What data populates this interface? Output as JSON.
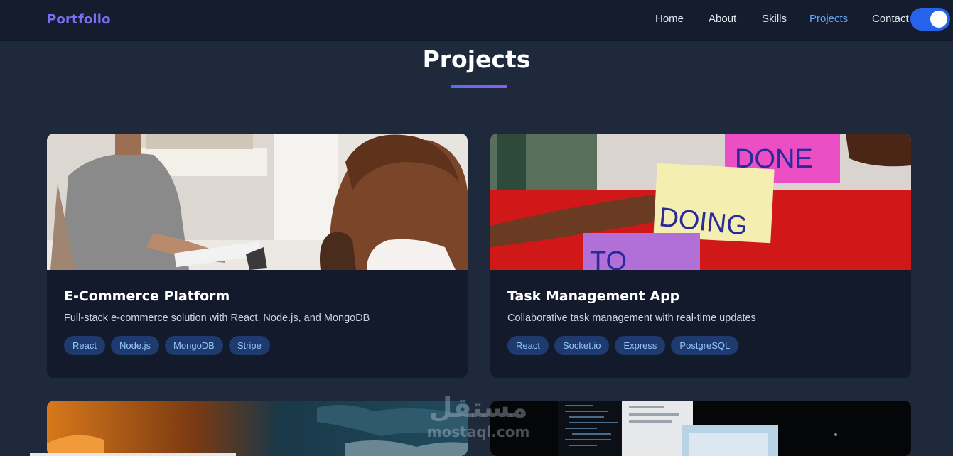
{
  "nav": {
    "logo": "Portfolio",
    "links": [
      {
        "label": "Home",
        "active": false
      },
      {
        "label": "About",
        "active": false
      },
      {
        "label": "Skills",
        "active": false
      },
      {
        "label": "Projects",
        "active": true
      },
      {
        "label": "Contact",
        "active": false
      }
    ],
    "theme_toggle": {
      "on": true
    }
  },
  "section": {
    "title": "Projects"
  },
  "projects": [
    {
      "title": "E-Commerce Platform",
      "description": "Full-stack e-commerce solution with React, Node.js, and MongoDB",
      "tags": [
        "React",
        "Node.js",
        "MongoDB",
        "Stripe"
      ]
    },
    {
      "title": "Task Management App",
      "description": "Collaborative task management with real-time updates",
      "tags": [
        "React",
        "Socket.io",
        "Express",
        "PostgreSQL"
      ],
      "image_notes": [
        "DONE",
        "DOING",
        "TO"
      ]
    }
  ],
  "watermark": {
    "arabic": "مستقل",
    "latin": "mostaql.com"
  },
  "colors": {
    "background": "#1e293b",
    "navbar": "#151c2e",
    "card": "#121a2b",
    "accent": "#60a5fa",
    "tag_bg": "#1e3a6e",
    "tag_text": "#93c5fd",
    "toggle": "#2563eb"
  }
}
